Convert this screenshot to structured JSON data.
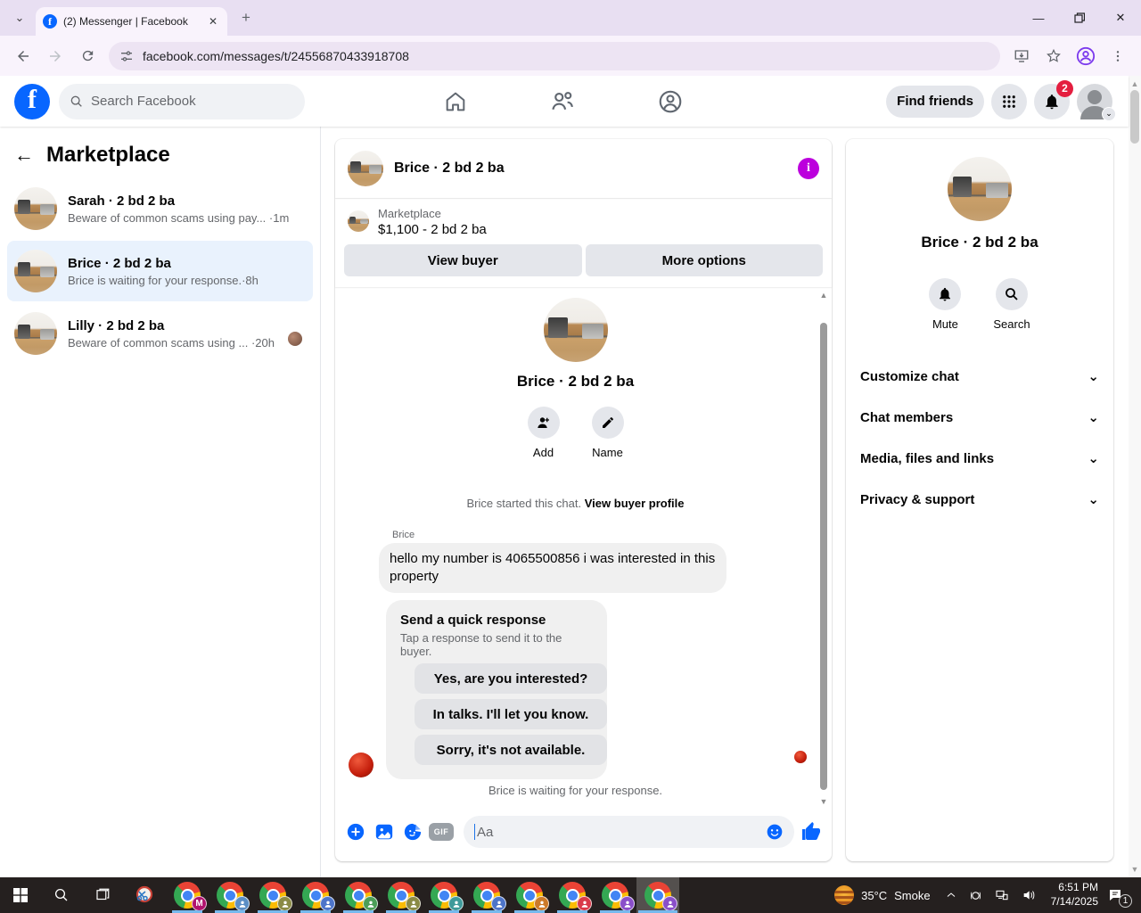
{
  "browser": {
    "tab_title": "(2) Messenger | Facebook",
    "url": "facebook.com/messages/t/24556870433918708"
  },
  "fb_nav": {
    "search_placeholder": "Search Facebook",
    "find_friends_label": "Find friends",
    "notification_count": "2"
  },
  "sidebar": {
    "title": "Marketplace",
    "conversations": [
      {
        "name": "Sarah · 2 bd 2 ba",
        "preview": "Beware of common scams using pay...",
        "time": "·1m"
      },
      {
        "name": "Brice · 2 bd 2 ba",
        "preview": "Brice is waiting for your response.",
        "time": "·8h"
      },
      {
        "name": "Lilly · 2 bd 2 ba",
        "preview": "Beware of common scams using ...",
        "time": "·20h"
      }
    ]
  },
  "chat": {
    "header_title": "Brice · 2 bd 2 ba",
    "marketplace_label": "Marketplace",
    "listing": "$1,100 - 2 bd 2 ba",
    "view_buyer_label": "View buyer",
    "more_options_label": "More options",
    "profile_title": "Brice · 2 bd 2 ba",
    "add_label": "Add",
    "name_label": "Name",
    "started_text": "Brice started this chat.",
    "view_buyer_profile_label": "View buyer profile",
    "sender": "Brice",
    "message": "hello my number is 4065500856 i was interested in this property",
    "quick_response_title": "Send a quick response",
    "quick_response_subtitle": "Tap a response to send it to the buyer.",
    "quick_responses": [
      "Yes, are you interested?",
      "In talks. I'll let you know.",
      "Sorry, it's not available."
    ],
    "waiting_text": "Brice is waiting for your response.",
    "composer_placeholder": "Aa",
    "gif_label": "GIF"
  },
  "details_panel": {
    "title": "Brice · 2 bd 2 ba",
    "mute_label": "Mute",
    "search_label": "Search",
    "menu": [
      "Customize chat",
      "Chat members",
      "Media, files and links",
      "Privacy & support"
    ]
  },
  "taskbar": {
    "weather_temp": "35°C",
    "weather_label": "Smoke",
    "time": "6:51 PM",
    "date": "7/14/2025",
    "notification_count": "1",
    "chrome_profiles": [
      {
        "type": "letter",
        "label": "M",
        "color": "#b0136e"
      },
      {
        "type": "person",
        "color": "#5b8ec4"
      },
      {
        "type": "person",
        "color": "#8a8a45"
      },
      {
        "type": "person",
        "color": "#4d74c9"
      },
      {
        "type": "person",
        "color": "#4c9e57"
      },
      {
        "type": "person",
        "color": "#8a8a45"
      },
      {
        "type": "person",
        "color": "#3f9a9a"
      },
      {
        "type": "person",
        "color": "#4d74c9"
      },
      {
        "type": "person",
        "color": "#cc7a29"
      },
      {
        "type": "person",
        "color": "#d93a4a"
      },
      {
        "type": "person",
        "color": "#8a4fc9"
      },
      {
        "type": "person",
        "color": "#8a4fc9",
        "active": true
      }
    ]
  },
  "colors": {
    "facebook_blue": "#0866ff",
    "badge_red": "#e41e3f",
    "info_purple": "#bc00dd",
    "selected_conversation": "#e9f2fd",
    "taskbar_underline": "#76b9ed"
  }
}
